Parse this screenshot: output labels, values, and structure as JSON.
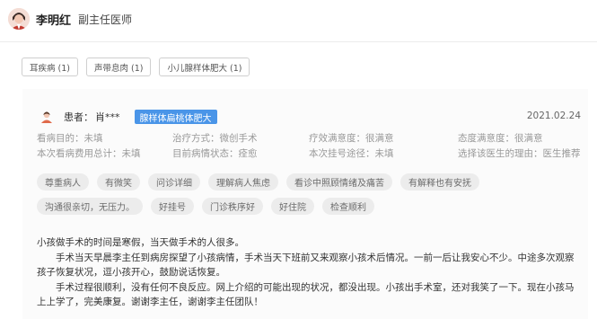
{
  "doctor": {
    "name": "李明红",
    "title": "副主任医师",
    "avatar": "doctor-avatar-icon"
  },
  "tabs": [
    "耳疾病 (1)",
    "声带息肉 (1)",
    "小儿腺样体肥大 (1)"
  ],
  "review": {
    "patient_label": "患者：",
    "patient_name": "肖***",
    "disease_tag": "腺样体扁桃体肥大",
    "date": "2021.02.24",
    "info": {
      "row1": [
        "看病目的：未填",
        "治疗方式：微创手术",
        "疗效满意度：很满意",
        "态度满意度：很满意"
      ],
      "row2": [
        "本次看病费用总计：未填",
        "目前病情状态：痊愈",
        "本次挂号途径：未填",
        "选择该医生的理由：医生推荐"
      ]
    },
    "chips_row1": [
      "尊重病人",
      "有微笑",
      "问诊详细",
      "理解病人焦虑",
      "看诊中照顾情绪及痛苦",
      "有解释也有安抚"
    ],
    "chips_row2": [
      "沟通很亲切，无压力。",
      "好挂号",
      "门诊秩序好",
      "好住院",
      "检查顺利"
    ],
    "text": [
      "小孩做手术的时间是寒假，当天做手术的人很多。",
      "手术当天早晨李主任到病房探望了小孩病情，手术当天下班前又来观察小孩术后情况。一前一后让我安心不少。中途多次观察孩子恢复状况，逗小孩开心，鼓励说话恢复。",
      "手术过程很顺利，没有任何不良反应。网上介绍的可能出现的状况，都没出现。小孩出手术室，还对我笑了一下。现在小孩马上上学了，完美康复。谢谢李主任，谢谢李主任团队！"
    ]
  },
  "colors": {
    "tag_bg": "#4a95e8",
    "chip_bg": "#ececec",
    "card_bg": "#fbfbfb"
  }
}
